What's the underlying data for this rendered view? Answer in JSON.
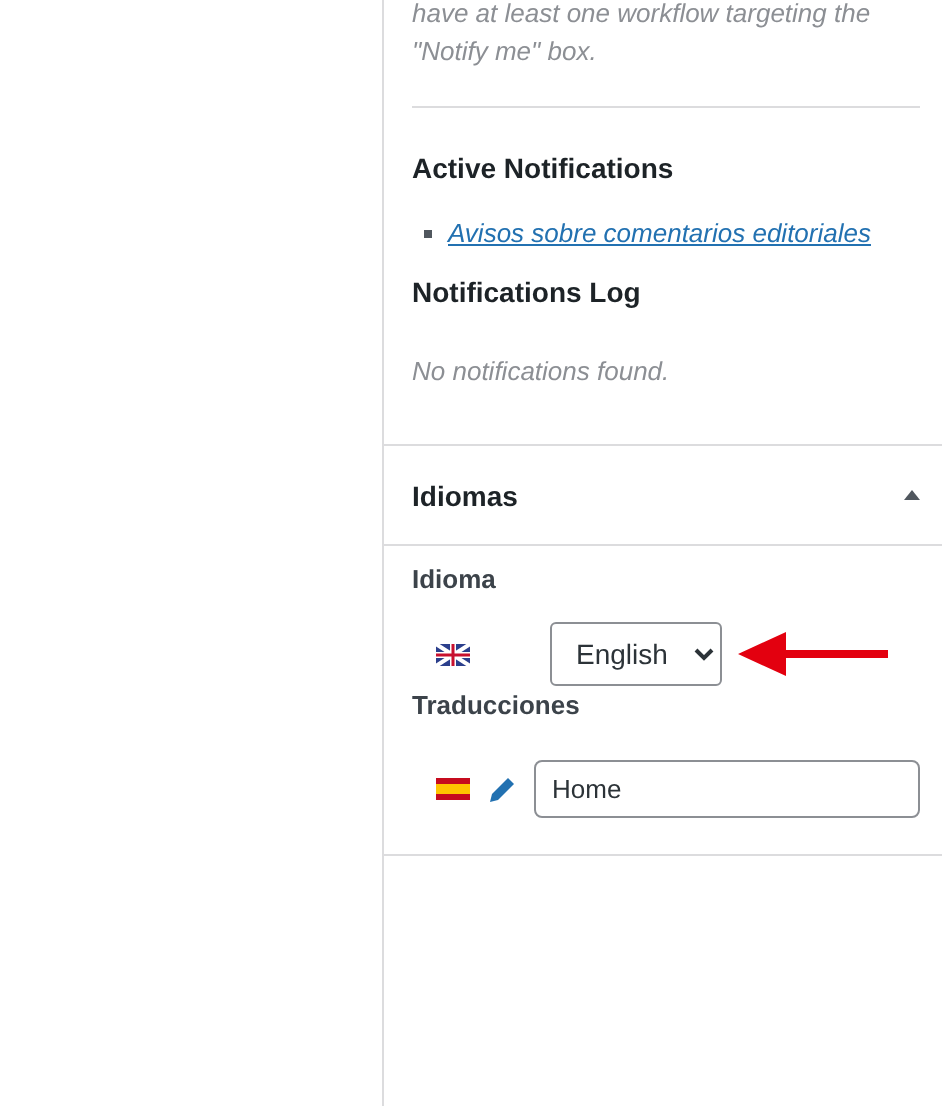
{
  "workflow_note": {
    "lines": [
      "have at least one workflow targeting the",
      "\"Notify me\" box."
    ]
  },
  "active_notifications": {
    "title": "Active Notifications",
    "items": [
      "Avisos sobre comentarios editoriales"
    ]
  },
  "notifications_log": {
    "title": "Notifications Log",
    "empty_text": "No notifications found."
  },
  "languages_box": {
    "title": "Idiomas",
    "expanded": true,
    "language": {
      "label": "Idioma",
      "value": "English"
    },
    "translations": {
      "label": "Traducciones",
      "value": "Home"
    }
  }
}
